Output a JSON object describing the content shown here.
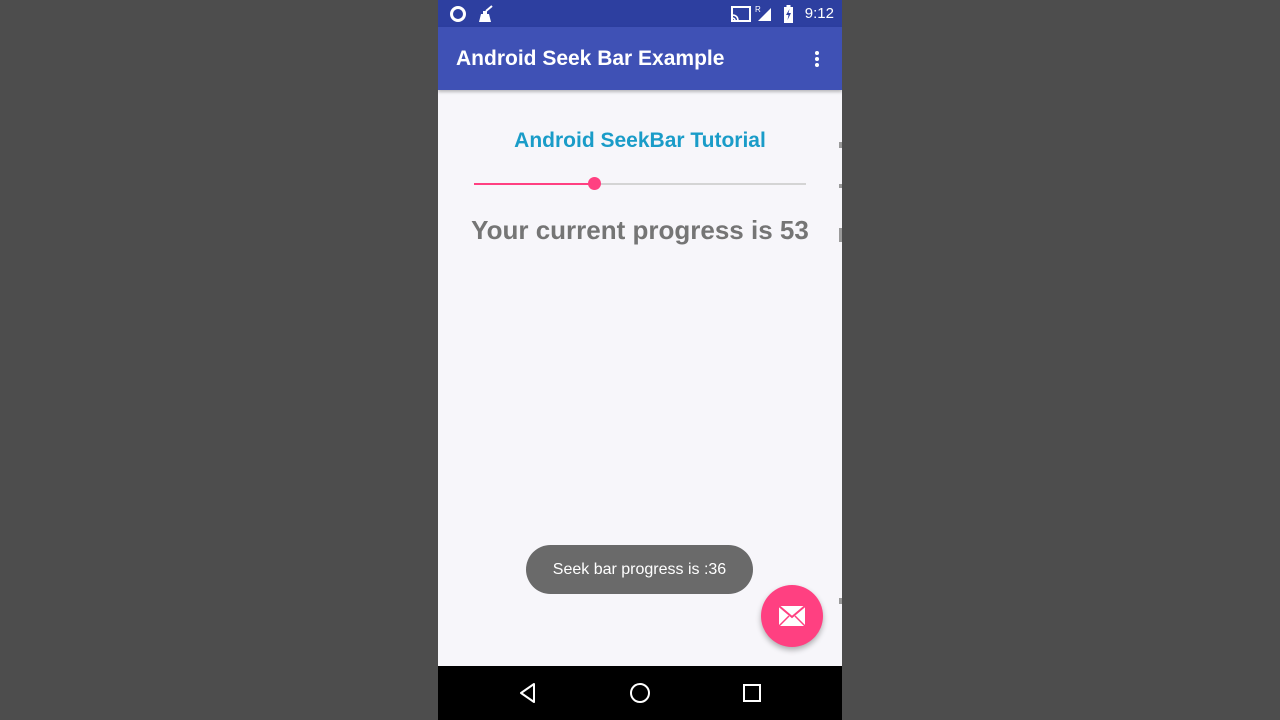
{
  "status_bar": {
    "time": "9:12",
    "left_icons": [
      "circle-notification-icon",
      "cleaner-icon"
    ],
    "right_icons": [
      "cast-icon",
      "signal-icon",
      "battery-charging-icon"
    ],
    "signal_label": "R"
  },
  "app_bar": {
    "title": "Android Seek Bar Example",
    "menu_icon": "more-vert-icon"
  },
  "content": {
    "heading": "Android SeekBar Tutorial",
    "seekbar": {
      "progress": 36,
      "max": 100
    },
    "progress_text": "Your current progress is 53"
  },
  "toast": {
    "message": "Seek bar progress is :36"
  },
  "fab": {
    "icon": "mail-icon"
  },
  "nav_bar": {
    "buttons": [
      "back-icon",
      "home-icon",
      "recents-icon"
    ]
  },
  "colors": {
    "status_bar": "#2d3fa0",
    "app_bar": "#3f51b5",
    "accent": "#ff4081",
    "heading": "#1a9cc8",
    "progress_text": "#757575",
    "background": "#f7f6fa",
    "outer_background": "#4d4d4d"
  }
}
